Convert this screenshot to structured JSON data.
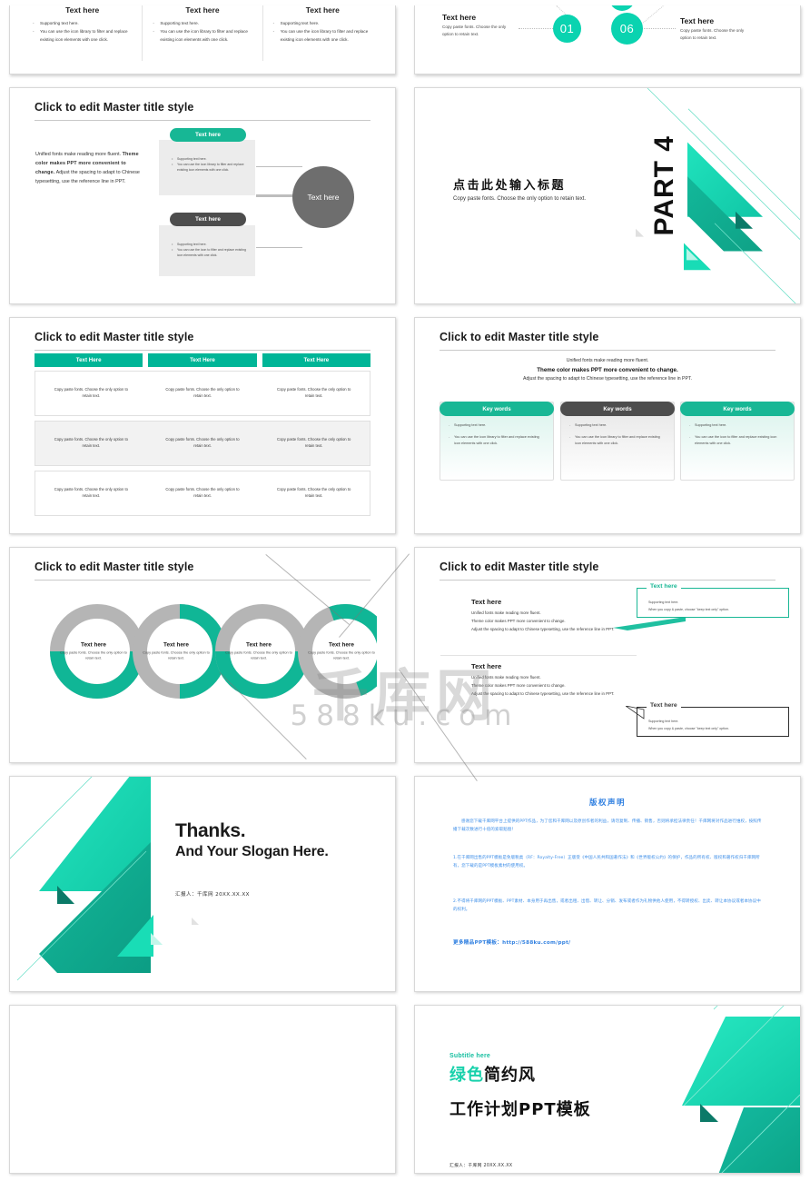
{
  "theme": {
    "green": "#00b597",
    "teal_bright": "#0ad3b0",
    "dark_grey": "#4d4d4d",
    "blue_text": "#3d8ee8"
  },
  "watermark": {
    "cn": "千库网",
    "en": "588ku.com"
  },
  "slides": {
    "bullets3": {
      "columns": [
        {
          "heading": "Text here",
          "items": [
            "Supporting text here.",
            "You can use the icon library to filter and replace existing icon elements with one click."
          ]
        },
        {
          "heading": "Text here",
          "items": [
            "Supporting text here.",
            "You can use the icon library to filter and replace existing icon elements with one click."
          ]
        },
        {
          "heading": "Text here",
          "items": [
            "Supporting text here.",
            "You can use the icon library to filter and replace existing icon elements with one click."
          ]
        }
      ]
    },
    "numbered": {
      "left": {
        "heading": "Text here",
        "body": "Copy paste fonts. Choose the only option to retain text.",
        "number": "01"
      },
      "right": {
        "heading": "Text here",
        "body": "Copy paste fonts. Choose the only option to retain text.",
        "number": "06"
      }
    },
    "cards_circle": {
      "title": "Click to edit Master title style",
      "left_text_1": "Unified fonts make reading more fluent.",
      "left_text_2": "Theme color makes PPT more convenient to change.",
      "left_text_3": "Adjust the spacing to adapt to Chinese typesetting, use the reference line in PPT.",
      "card_top": {
        "pill": "Text here",
        "items": [
          "Supporting text here.",
          "You can use the icon library to filter and replace existing icon elements with one click."
        ]
      },
      "card_bottom": {
        "pill": "Text here",
        "items": [
          "Supporting text here.",
          "You can use the icon to filter and replace existing icon elements with one click."
        ]
      },
      "circle": "Text here"
    },
    "part_divider": {
      "title_cn": "点击此处输入标题",
      "subtitle": "Copy paste fonts. Choose the only option to retain text.",
      "label": "PART 4"
    },
    "table": {
      "title": "Click to edit Master title style",
      "headers": [
        "Text Here",
        "Text Here",
        "Text Here"
      ],
      "rows": [
        [
          "Copy paste fonts. Choose the only option to retain text.",
          "Copy paste fonts. Choose the only option to retain text.",
          "Copy paste fonts. Choose the only option to retain text."
        ],
        [
          "Copy paste fonts. Choose the only option to retain text.",
          "Copy paste fonts. Choose the only option to retain text.",
          "Copy paste fonts. Choose the only option to retain text."
        ],
        [
          "Copy paste fonts. Choose the only option to retain text.",
          "Copy paste fonts. Choose the only option to retain text.",
          "Copy paste fonts. Choose the only option to retain text."
        ]
      ]
    },
    "keywords": {
      "title": "Click to edit Master title style",
      "intro_1": "Unified fonts make reading more fluent.",
      "intro_2": "Theme color makes PPT more convenient to change.",
      "intro_3": "Adjust the spacing to adapt to Chinese typesetting, use the reference line in PPT.",
      "cards": [
        {
          "head": "Key words",
          "items": [
            "Supporting text here.",
            "You can use the icon library to filter and replace existing icon elements with one click."
          ]
        },
        {
          "head": "Key words",
          "items": [
            "Supporting text here.",
            "You can use the icon library to filter and replace existing icon elements with one click."
          ]
        },
        {
          "head": "Key words",
          "items": [
            "Supporting text here.",
            "You can use the icon to filter and replace existing icon elements with one click."
          ]
        }
      ]
    },
    "rings": {
      "title": "Click to edit Master title style",
      "items": [
        {
          "heading": "Text here",
          "body": "Copy paste fonts. Choose the only option to retain text."
        },
        {
          "heading": "Text here",
          "body": "Copy paste fonts. Choose the only option to retain text."
        },
        {
          "heading": "Text here",
          "body": "Copy paste fonts. Choose the only option to retain text."
        },
        {
          "heading": "Text here",
          "body": "Copy paste fonts. Choose the only option to retain text."
        }
      ]
    },
    "callouts": {
      "title": "Click to edit Master title style",
      "block_1": {
        "heading": "Text here",
        "line1": "Unified fonts make reading more fluent.",
        "line2": "Theme color makes PPT more convenient to change.",
        "line3": "Adjust the spacing to adapt to Chinese typesetting, use the reference line in PPT."
      },
      "block_2": {
        "heading": "Text here",
        "line1": "Unified fonts make reading more fluent.",
        "line2": "Theme color makes PPT more convenient to change.",
        "line3": "Adjust the spacing to adapt to Chinese typesetting, use the reference line in PPT."
      },
      "callout_1": {
        "title": "Text here",
        "line1": "Supporting text here.",
        "line2": "When you copy & paste, choose \"keep text only\" option."
      },
      "callout_2": {
        "title": "Text here",
        "line1": "Supporting text here.",
        "line2": "When you copy & paste, choose \"keep text only\" option."
      }
    },
    "thanks": {
      "line1": "Thanks.",
      "line2": "And Your Slogan Here.",
      "footer": "汇报人：千库网    20XX.XX.XX"
    },
    "copyright": {
      "title": "版权声明",
      "p1": "感谢您下载千库网平台上提供的PPT作品，为了您和千库网以及原创作者的利益，请勿复制、传播、销售，否则将承担法律责任！千库网将对作品进行维权，按照传播下载次数进行十倍的索取赔偿！",
      "p2": "1.在千库网出售的PPT模板是免版税类（RF：Royalty-Free）正版受《中国人民共和国著作法》和《世界版权公约》的保护，作品的所有权、版权和著作权归千库网所有，您下载的是PPT模板素材的使用权。",
      "p3": "2.不得将千库网的PPT模板、PPT素材、本身用于再出售，或者出租、出借、转让、分销、发布或者作为礼物供他人使用，不得转授权、出卖、转让本协议或者本协议中的权利。",
      "link": "更多精品PPT模板：http://588ku.com/ppt/"
    },
    "cover": {
      "subtitle": "Subtitle here",
      "title_hl": "绿色",
      "title_rest": "简约风",
      "title_line2": "工作计划PPT模板",
      "footer": "汇报人：千库网      20XX.XX.XX"
    }
  }
}
